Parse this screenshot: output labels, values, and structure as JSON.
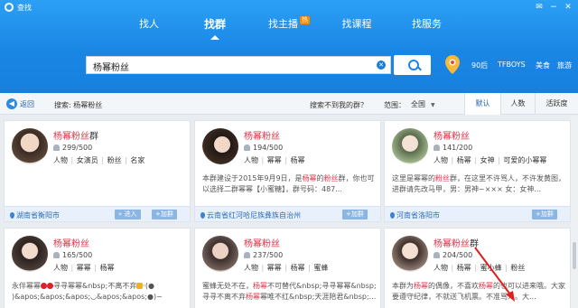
{
  "window": {
    "title": "查找",
    "controls": [
      "✉",
      "−",
      "✕"
    ]
  },
  "tabs": [
    {
      "label": "找人",
      "active": false
    },
    {
      "label": "找群",
      "active": true
    },
    {
      "label": "找主播",
      "active": false,
      "badge": "热"
    },
    {
      "label": "找课程",
      "active": false
    },
    {
      "label": "找服务",
      "active": false
    }
  ],
  "search": {
    "value": "杨幂粉丝",
    "clear_icon": "clear-icon",
    "button_icon": "search-icon"
  },
  "quick_tags": [
    "90后",
    "TFBOYS",
    "美食",
    "旅游"
  ],
  "filter": {
    "back_label": "返回",
    "query_label": "搜索: 杨幂粉丝",
    "not_found_label": "搜索不到我的群？",
    "range_label": "范围：",
    "range_value": "全国",
    "sort": [
      {
        "label": "默认",
        "active": true
      },
      {
        "label": "人数",
        "active": false
      },
      {
        "label": "活跃度",
        "active": false
      }
    ]
  },
  "cards": [
    {
      "name_hl": "杨幂粉丝",
      "name_rest": "群",
      "members": "299/500",
      "tags": [
        "人物",
        "女演员",
        "粉丝",
        "名家"
      ],
      "desc": "",
      "location": "湖南省衡阳市",
      "enter_label": "进入",
      "join_label": "加群"
    },
    {
      "name_hl": "杨幂粉丝",
      "name_rest": "",
      "members": "194/500",
      "tags": [
        "人物",
        "幂幂",
        "杨幂"
      ],
      "desc_parts": [
        "本群建设于2015年9月9日，是",
        "杨幂",
        "的",
        "粉丝",
        "群，你也可以选择二群幂幂【小蜜糖】，群号码：487..."
      ],
      "location": "云南省红河哈尼族彝族自治州",
      "join_label": "加群"
    },
    {
      "name_hl": "杨幂粉丝",
      "name_rest": "",
      "members": "141/200",
      "tags": [
        "人物",
        "杨幂",
        "女神",
        "可爱的小幂幂"
      ],
      "desc_parts": [
        "这里是幂幂的",
        "粉丝",
        "群，在这里不许骂人，不许发黄图，进群请先改马甲，男：男神~×××  女：女神..."
      ],
      "location": "河南省洛阳市",
      "join_label": "加群"
    },
    {
      "name_hl": "杨幂粉丝",
      "name_rest": "",
      "members": "165/500",
      "tags": [
        "人物",
        "幂幂",
        "杨幂"
      ],
      "desc_lines": [
        "永伴幂幂",
        "寻寻幂幂&nbsp;不离不弃",
        "·(●",
        ")&apos;&apos;&apos;◡&apos;&apos;●)~"
      ],
      "location": "",
      "join_label": "加群"
    },
    {
      "name_hl": "杨幂粉丝",
      "name_rest": "",
      "members": "237/500",
      "tags": [
        "人物",
        "幂幂",
        "杨幂",
        "蜜蜂"
      ],
      "desc_lines": [
        "蜜蜂无处不在，",
        "杨幂",
        "不可替代&nbsp;寻寻幂幂&nbsp;寻寻不离不弃",
        "杨幂",
        "幂唯不红&nbsp;天涯陪君&nbsp;..."
      ],
      "location": "",
      "join_label": "加群"
    },
    {
      "name_hl": "杨幂粉丝",
      "name_rest": "群",
      "members": "204/500",
      "tags": [
        "人物",
        "杨幂",
        "蜜小蜂",
        "粉丝"
      ],
      "desc_lines": [
        "本群为",
        "杨幂",
        "的偶像，不喜欢",
        "杨幂",
        "的也可以进来哦。大家要遵守纪律，不就送飞机票。不准骂人。大..."
      ],
      "location": "",
      "join_label": "加群"
    }
  ],
  "colors": {
    "brand": "#1a86e4",
    "highlight": "#e0344a",
    "link": "#2c6cb8"
  }
}
